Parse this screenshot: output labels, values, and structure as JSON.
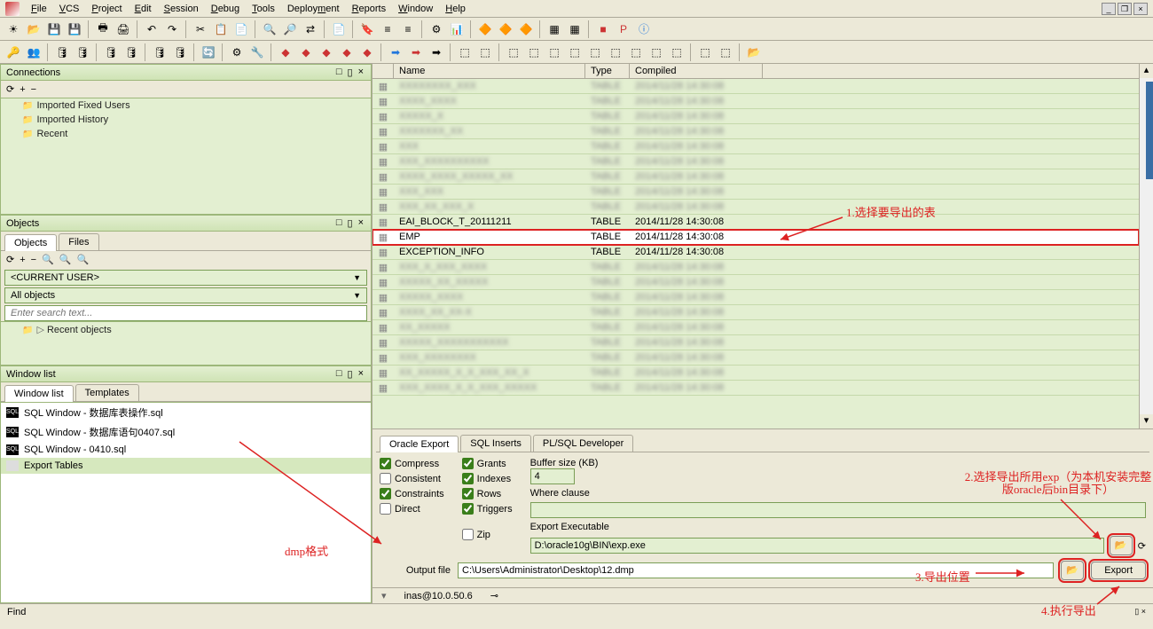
{
  "menu": {
    "items": [
      "File",
      "VCS",
      "Project",
      "Edit",
      "Session",
      "Debug",
      "Tools",
      "Deployment",
      "Reports",
      "Window",
      "Help"
    ]
  },
  "panels": {
    "connections": {
      "title": "Connections",
      "items": [
        "Imported Fixed Users",
        "Imported History",
        "Recent"
      ]
    },
    "objects": {
      "title": "Objects",
      "tabs": [
        "Objects",
        "Files"
      ],
      "current_user": "<CURRENT USER>",
      "all_objects": "All objects",
      "search_ph": "Enter search text...",
      "recent": "Recent objects"
    },
    "windowlist": {
      "title": "Window list",
      "tabs": [
        "Window list",
        "Templates"
      ],
      "items": [
        "SQL Window - 数据库表操作.sql",
        "SQL Window - 数据库语句0407.sql",
        "SQL Window - 0410.sql",
        "Export Tables"
      ]
    }
  },
  "grid": {
    "headers": {
      "name": "Name",
      "type": "Type",
      "compiled": "Compiled"
    },
    "rows": [
      {
        "name": "XXXXXXXX_XXX",
        "type": "TABLE",
        "compiled": "2014/11/28 14:30:08",
        "blur": true
      },
      {
        "name": "XXXX_XXXX",
        "type": "TABLE",
        "compiled": "2014/11/28 14:30:08",
        "blur": true
      },
      {
        "name": "XXXXX_X",
        "type": "TABLE",
        "compiled": "2014/11/28 14:30:08",
        "blur": true
      },
      {
        "name": "XXXXXXX_XX",
        "type": "TABLE",
        "compiled": "2014/11/28 14:30:08",
        "blur": true
      },
      {
        "name": "XXX",
        "type": "TABLE",
        "compiled": "2014/11/28 14:30:08",
        "blur": true
      },
      {
        "name": "XXX_XXXXXXXXXX",
        "type": "TABLE",
        "compiled": "2014/11/28 14:30:08",
        "blur": true
      },
      {
        "name": "XXXX_XXXX_XXXXX_XX",
        "type": "TABLE",
        "compiled": "2014/11/28 14:30:08",
        "blur": true
      },
      {
        "name": "XXX_XXX",
        "type": "TABLE",
        "compiled": "2014/11/28 14:30:08",
        "blur": true
      },
      {
        "name": "XXX_XX_XXX_X",
        "type": "TABLE",
        "compiled": "2014/11/28 14:30:08",
        "blur": true
      },
      {
        "name": "EAI_BLOCK_T_20111211",
        "type": "TABLE",
        "compiled": "2014/11/28 14:30:08",
        "blur": false
      },
      {
        "name": "EMP",
        "type": "TABLE",
        "compiled": "2014/11/28 14:30:08",
        "blur": false,
        "selected": true
      },
      {
        "name": "EXCEPTION_INFO",
        "type": "TABLE",
        "compiled": "2014/11/28 14:30:08",
        "blur": false
      },
      {
        "name": "XXX_X_XXX_XXXX",
        "type": "TABLE",
        "compiled": "2014/11/28 14:30:08",
        "blur": true
      },
      {
        "name": "XXXXX_XX_XXXXX",
        "type": "TABLE",
        "compiled": "2014/11/28 14:30:08",
        "blur": true
      },
      {
        "name": "XXXXX_XXXX",
        "type": "TABLE",
        "compiled": "2014/11/28 14:30:08",
        "blur": true
      },
      {
        "name": "XXXX_XX_XX-X",
        "type": "TABLE",
        "compiled": "2014/11/28 14:30:08",
        "blur": true
      },
      {
        "name": "XX_XXXXX",
        "type": "TABLE",
        "compiled": "2014/11/28 14:30:08",
        "blur": true
      },
      {
        "name": "XXXXX_XXXXXXXXXXX",
        "type": "TABLE",
        "compiled": "2014/11/28 14:30:08",
        "blur": true
      },
      {
        "name": "XXX_XXXXXXXX",
        "type": "TABLE",
        "compiled": "2014/11/28 14:30:08",
        "blur": true
      },
      {
        "name": "XX_XXXXX_X_X_XXX_XX_X",
        "type": "TABLE",
        "compiled": "2014/11/28 14:30:08",
        "blur": true
      },
      {
        "name": "XXX_XXXX_X_X_XXX_XXXXX",
        "type": "TABLE",
        "compiled": "2014/11/28 14:30:08",
        "blur": true
      }
    ]
  },
  "export": {
    "tabs": [
      "Oracle Export",
      "SQL Inserts",
      "PL/SQL Developer"
    ],
    "checks": {
      "compress": {
        "label": "Compress",
        "checked": true
      },
      "consistent": {
        "label": "Consistent",
        "checked": false
      },
      "constraints": {
        "label": "Constraints",
        "checked": true
      },
      "direct": {
        "label": "Direct",
        "checked": false
      },
      "grants": {
        "label": "Grants",
        "checked": true
      },
      "indexes": {
        "label": "Indexes",
        "checked": true
      },
      "rows": {
        "label": "Rows",
        "checked": true
      },
      "triggers": {
        "label": "Triggers",
        "checked": true
      },
      "zip": {
        "label": "Zip",
        "checked": false
      }
    },
    "buffer_label": "Buffer size (KB)",
    "buffer_value": "4",
    "where_label": "Where clause",
    "where_value": "",
    "exe_label": "Export Executable",
    "exe_value": "D:\\oracle10g\\BIN\\exp.exe",
    "out_label": "Output file",
    "out_value": "C:\\Users\\Administrator\\Desktop\\12.dmp",
    "export_btn": "Export"
  },
  "status": {
    "conn": "inas@10.0.50.6"
  },
  "find": {
    "label": "Find"
  },
  "annotations": {
    "a1": "1.选择要导出的表",
    "a2": "2.选择导出所用exp（为本机安装完整版oracle后bin目录下）",
    "a3": "3.导出位置",
    "a4": "4.执行导出",
    "dmp": "dmp格式"
  }
}
